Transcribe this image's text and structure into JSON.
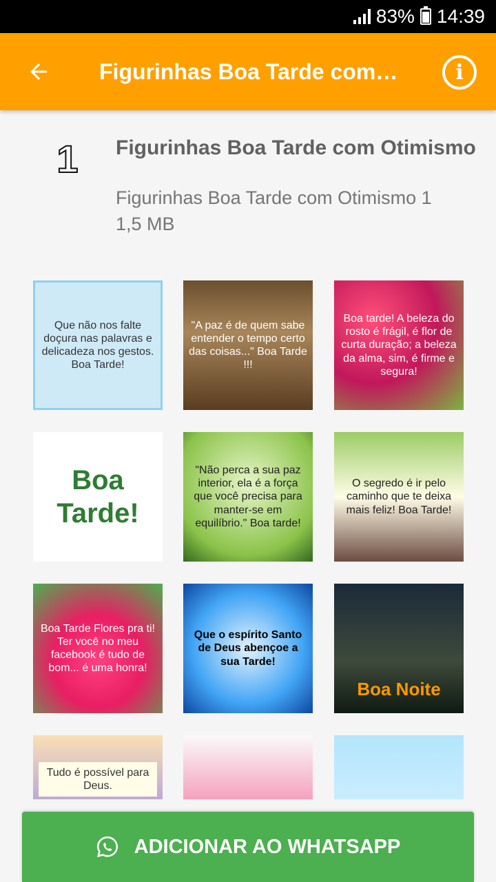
{
  "status": {
    "battery": "83%",
    "time": "14:39"
  },
  "appbar": {
    "title": "Figurinhas Boa Tarde com Otimismo"
  },
  "pack": {
    "tray_number": "1",
    "name": "Figurinhas Boa Tarde com Otimismo",
    "publisher": "Figurinhas Boa Tarde com Otimismo 1",
    "size": "1,5 MB"
  },
  "stickers": [
    {
      "text": "Que não nos falte doçura nas palavras e delicadeza nos gestos. Boa Tarde!"
    },
    {
      "text": "\"A paz é de quem sabe entender o tempo certo das coisas...\" Boa Tarde !!!"
    },
    {
      "text": "Boa tarde! A beleza do rosto é frágil, é flor de curta duração; a beleza da alma, sim, é firme e segura!"
    },
    {
      "text": "Boa Tarde!"
    },
    {
      "text": "\"Não perca a sua paz interior, ela é a força que você precisa para manter-se em equilíbrio.\" Boa tarde!"
    },
    {
      "text": "O segredo é ir pelo caminho que te deixa mais feliz! Boa Tarde!"
    },
    {
      "text": "Boa Tarde Flores pra ti! Ter você no meu facebook é tudo de bom... é uma honra!"
    },
    {
      "text": "Que o espírito Santo de Deus abençoe a sua Tarde!"
    },
    {
      "text": "Boa Noite"
    },
    {
      "text": "Tudo é possível para Deus."
    },
    {
      "text": ""
    },
    {
      "text": ""
    }
  ],
  "action": {
    "label": "ADICIONAR AO WHATSAPP"
  }
}
